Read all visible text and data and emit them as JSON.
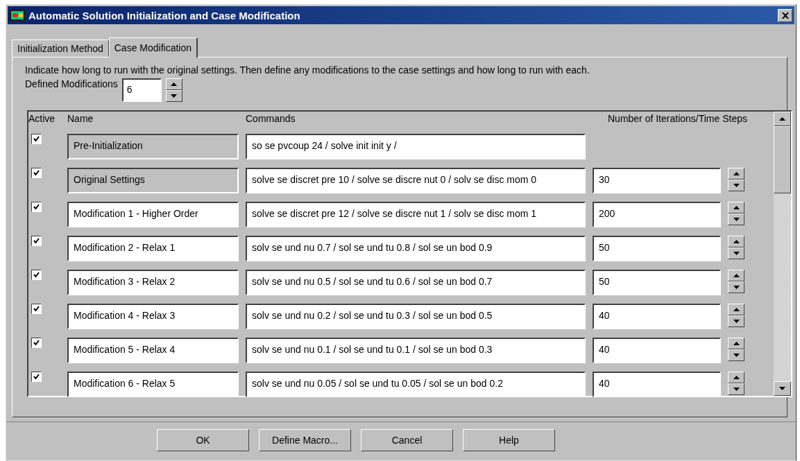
{
  "window": {
    "title": "Automatic Solution Initialization and Case Modification"
  },
  "tabs": [
    {
      "label": "Initialization Method",
      "selected": false
    },
    {
      "label": "Case Modification",
      "selected": true
    }
  ],
  "intro": "Indicate how long to run with the original settings. Then define any modifications to the case settings and how long to run with each.",
  "defined_modifications": {
    "label": "Defined Modifications",
    "value": "6"
  },
  "table": {
    "columns": [
      "Active",
      "Name",
      "Commands",
      "Number of Iterations/Time Steps"
    ],
    "rows": [
      {
        "active": true,
        "name": "Pre-Initialization",
        "name_disabled": true,
        "commands": "so se pvcoup 24 / solve init init y /"
      },
      {
        "active": true,
        "name": "Original Settings",
        "name_disabled": true,
        "commands": "solve se discret pre 10 / solve se discre nut 0 / solv se disc mom 0",
        "iterations": "30"
      },
      {
        "active": true,
        "name": "Modification 1 - Higher Order",
        "name_disabled": false,
        "commands": "solve se discret pre 12 / solve se discre nut 1 / solv se disc mom 1",
        "iterations": "200"
      },
      {
        "active": true,
        "name": "Modification 2 - Relax 1",
        "name_disabled": false,
        "commands": "solv se und nu 0.7 / sol se und tu 0.8 / sol se un bod 0.9",
        "iterations": "50"
      },
      {
        "active": true,
        "name": "Modification 3 - Relax 2",
        "name_disabled": false,
        "commands": "solv se und nu 0.5 / sol se und tu 0.6 / sol se un bod 0.7",
        "iterations": "50"
      },
      {
        "active": true,
        "name": "Modification 4 - Relax 3",
        "name_disabled": false,
        "commands": "solv se und nu 0.2 / sol se und tu 0.3 / sol se un bod 0.5",
        "iterations": "40"
      },
      {
        "active": true,
        "name": "Modification 5 - Relax 4",
        "name_disabled": false,
        "commands": "solv se und nu 0.1 / sol se und tu 0.1 / sol se un bod 0.3",
        "iterations": "40"
      },
      {
        "active": true,
        "name": "Modification 6 - Relax 5",
        "name_disabled": false,
        "commands": "solv se und nu 0.05 / sol se und tu 0.05 / sol se un bod 0.2",
        "iterations": "40"
      }
    ]
  },
  "buttons": [
    "OK",
    "Define Macro...",
    "Cancel",
    "Help"
  ]
}
